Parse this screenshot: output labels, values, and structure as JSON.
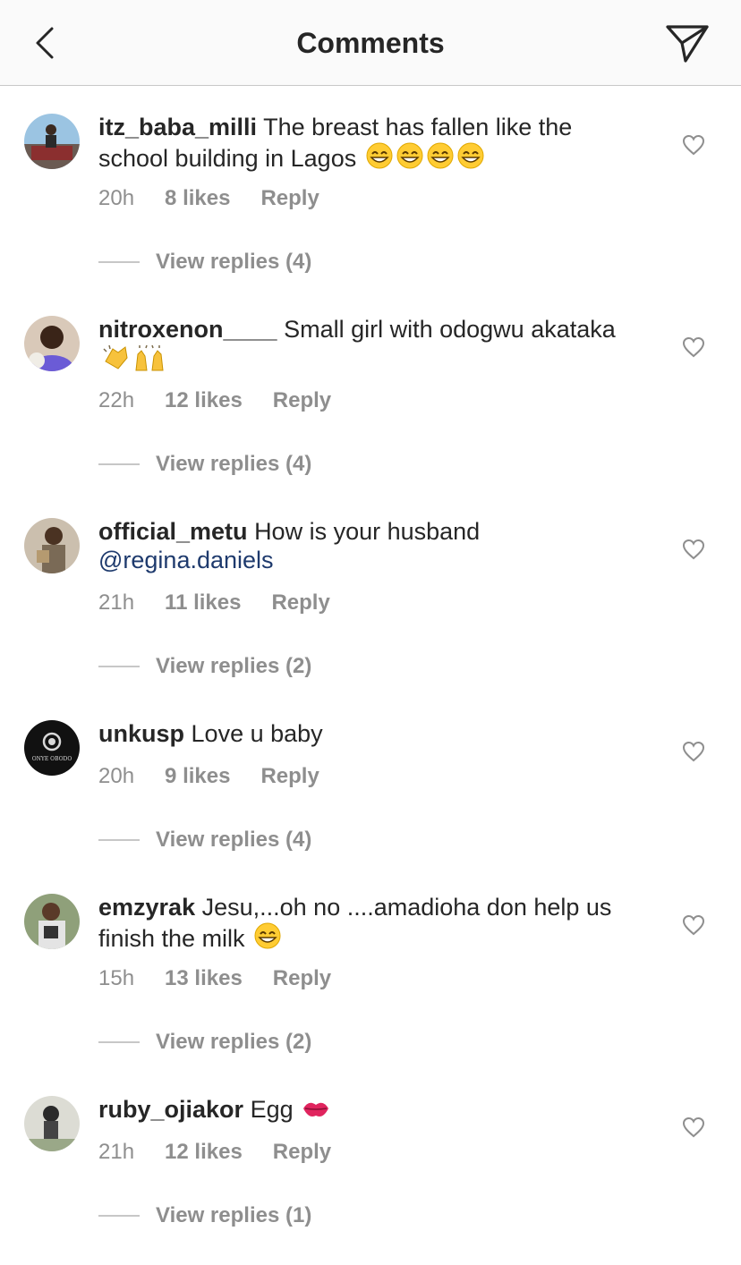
{
  "header": {
    "title": "Comments",
    "back_icon": "chevron-left-icon",
    "share_icon": "send-icon"
  },
  "colors": {
    "text": "#262626",
    "muted": "#8e8e8e",
    "mention": "#1e3a6d",
    "header_bg": "#fafafa"
  },
  "comments": [
    {
      "username": "itz_baba_milli",
      "text": "The breast has fallen like the school building in Lagos",
      "emojis": [
        "grinning-face",
        "grinning-face",
        "grinning-face",
        "grinning-face"
      ],
      "time": "20h",
      "likes": "8 likes",
      "reply": "Reply",
      "view_replies": "View replies (4)"
    },
    {
      "username": "nitroxenon____",
      "text": "Small girl with odogwu akataka",
      "emojis": [
        "clapping-hands",
        "raising-hands"
      ],
      "time": "22h",
      "likes": "12 likes",
      "reply": "Reply",
      "view_replies": "View replies (4)"
    },
    {
      "username": "official_metu",
      "text": "How is your husband",
      "mention": "@regina.daniels",
      "time": "21h",
      "likes": "11 likes",
      "reply": "Reply",
      "view_replies": "View replies (2)"
    },
    {
      "username": "unkusp",
      "text": "Love u baby",
      "avatar_text": "ONYE OBODO",
      "time": "20h",
      "likes": "9 likes",
      "reply": "Reply",
      "view_replies": "View replies (4)"
    },
    {
      "username": "emzyrak",
      "text": "Jesu,...oh no ....amadioha don help us finish the milk",
      "emojis": [
        "grinning-face"
      ],
      "time": "15h",
      "likes": "13 likes",
      "reply": "Reply",
      "view_replies": "View replies (2)"
    },
    {
      "username": "ruby_ojiakor",
      "text": "Egg",
      "emojis": [
        "kiss-mark"
      ],
      "time": "21h",
      "likes": "12 likes",
      "reply": "Reply",
      "view_replies": "View replies (1)"
    }
  ]
}
